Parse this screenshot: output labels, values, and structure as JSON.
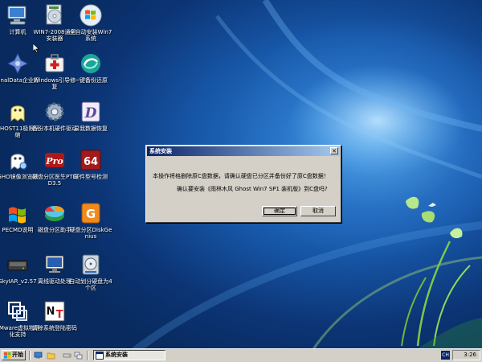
{
  "desktop": {
    "icons": [
      {
        "label": "计算机",
        "icon": "computer-icon"
      },
      {
        "label": "WIN7-2008通用安装器",
        "icon": "installer-disc-icon"
      },
      {
        "label": "全自动安装Win7系统",
        "icon": "windows-logo-icon"
      },
      {
        "label": "FinalData企业版",
        "icon": "finaldata-icon"
      },
      {
        "label": "Windows引导修复",
        "icon": "first-aid-box-icon"
      },
      {
        "label": "一键备份还原",
        "icon": "backup-swirl-icon"
      },
      {
        "label": "GHOST11极限压缩",
        "icon": "ghost-icon"
      },
      {
        "label": "备份本机硬件驱动",
        "icon": "gear-icon"
      },
      {
        "label": "易我数据恢复",
        "icon": "data-recovery-d-icon"
      },
      {
        "label": "GHO镜像浏览器",
        "icon": "ghost-explorer-icon"
      },
      {
        "label": "磁盘分区医生PTDD3.5",
        "icon": "pro-tool-icon"
      },
      {
        "label": "硬件型号检测",
        "icon": "hardware-64-icon"
      },
      {
        "label": "PECMD说明",
        "icon": "windows-flag-icon"
      },
      {
        "label": "磁盘分区助手",
        "icon": "partition-assistant-icon"
      },
      {
        "label": "硬盘分区DiskGenius",
        "icon": "diskgenius-icon"
      },
      {
        "label": "SkyIAR_v2.57",
        "icon": "skyiar-disk-icon"
      },
      {
        "label": "离线驱动处理",
        "icon": "monitor-driver-icon"
      },
      {
        "label": "自动划分硬盘为4个区",
        "icon": "harddisk-partition-icon"
      },
      {
        "label": "VMware虚拟物理化支持",
        "icon": "vmware-icon"
      },
      {
        "label": "清除系统登陆密码",
        "icon": "nt-password-icon"
      }
    ]
  },
  "dialog": {
    "title": "系统安装",
    "close_glyph": "✕",
    "message_line1": "本操作将格删除原C盘数据，请确认硬盘已分区并备份好了原C盘数据！",
    "message_line2": "确认要安装《雨林木风 Ghost Win7 SP1 装机版》到C盘吗?",
    "ok_label": "确定",
    "cancel_label": "取消"
  },
  "taskbar": {
    "start_label": "开始",
    "active_task_label": "系统安装",
    "language": "CH",
    "clock": "3:26"
  },
  "colors": {
    "titlebar_start": "#0a246a",
    "titlebar_end": "#a6caf0",
    "dialog_face": "#d4d0c8",
    "desktop_blue": "#1757a8"
  }
}
